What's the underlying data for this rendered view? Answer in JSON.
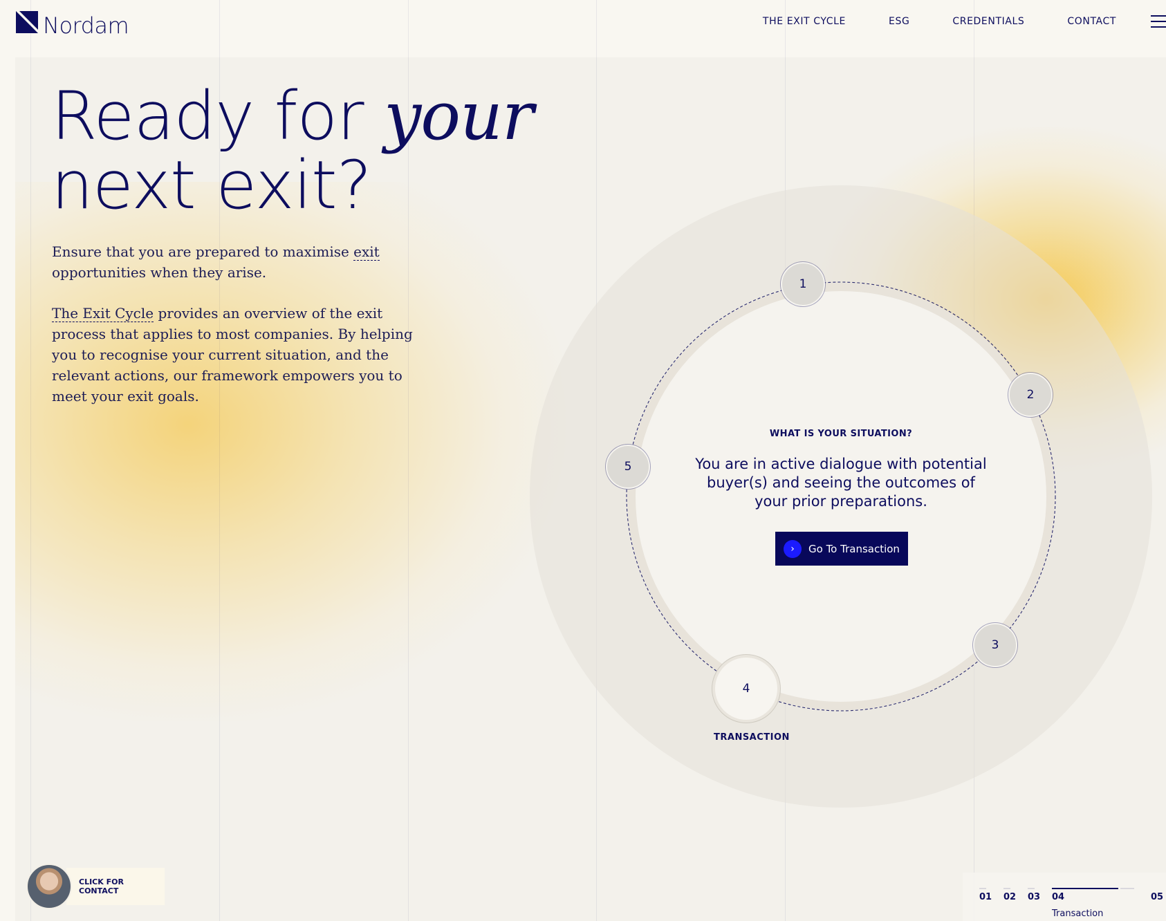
{
  "header": {
    "logo_text": "Nordam",
    "nav": [
      "THE EXIT CYCLE",
      "ESG",
      "CREDENTIALS",
      "CONTACT"
    ]
  },
  "hero": {
    "title_line1_plain": "Ready for ",
    "title_line1_italic": "your",
    "title_line2": "next exit?",
    "p1_before": "Ensure that you are prepared to maximise ",
    "p1_link": "exit",
    "p1_after": " opportunities when they arise.",
    "p2_link": "The Exit Cycle",
    "p2_after": " provides an overview of the exit process that applies to most companies. By helping you to recognise your current situation, and the relevant actions, our framework empowers you to meet your exit goals."
  },
  "cycle": {
    "nodes": [
      "1",
      "2",
      "3",
      "4",
      "5"
    ],
    "active_node_label": "TRANSACTION",
    "eyebrow": "WHAT IS YOUR SITUATION?",
    "situation": "You are in active dialogue with potential buyer(s) and seeing the outcomes of your prior preparations.",
    "cta_label": "Go To Transaction",
    "cta_icon": "chevron-right-icon"
  },
  "contact_chip": {
    "label": "CLICK FOR CONTACT"
  },
  "stepper": {
    "steps": [
      "01",
      "02",
      "03",
      "04",
      "05"
    ],
    "active_step": "04",
    "active_sub": "Transaction"
  },
  "colors": {
    "navy": "#0d0d5e",
    "background": "#f9f7f1",
    "accent_yellow": "#f5c850",
    "cta_bg": "#08085a",
    "cta_icon_bg": "#1b1bff"
  }
}
